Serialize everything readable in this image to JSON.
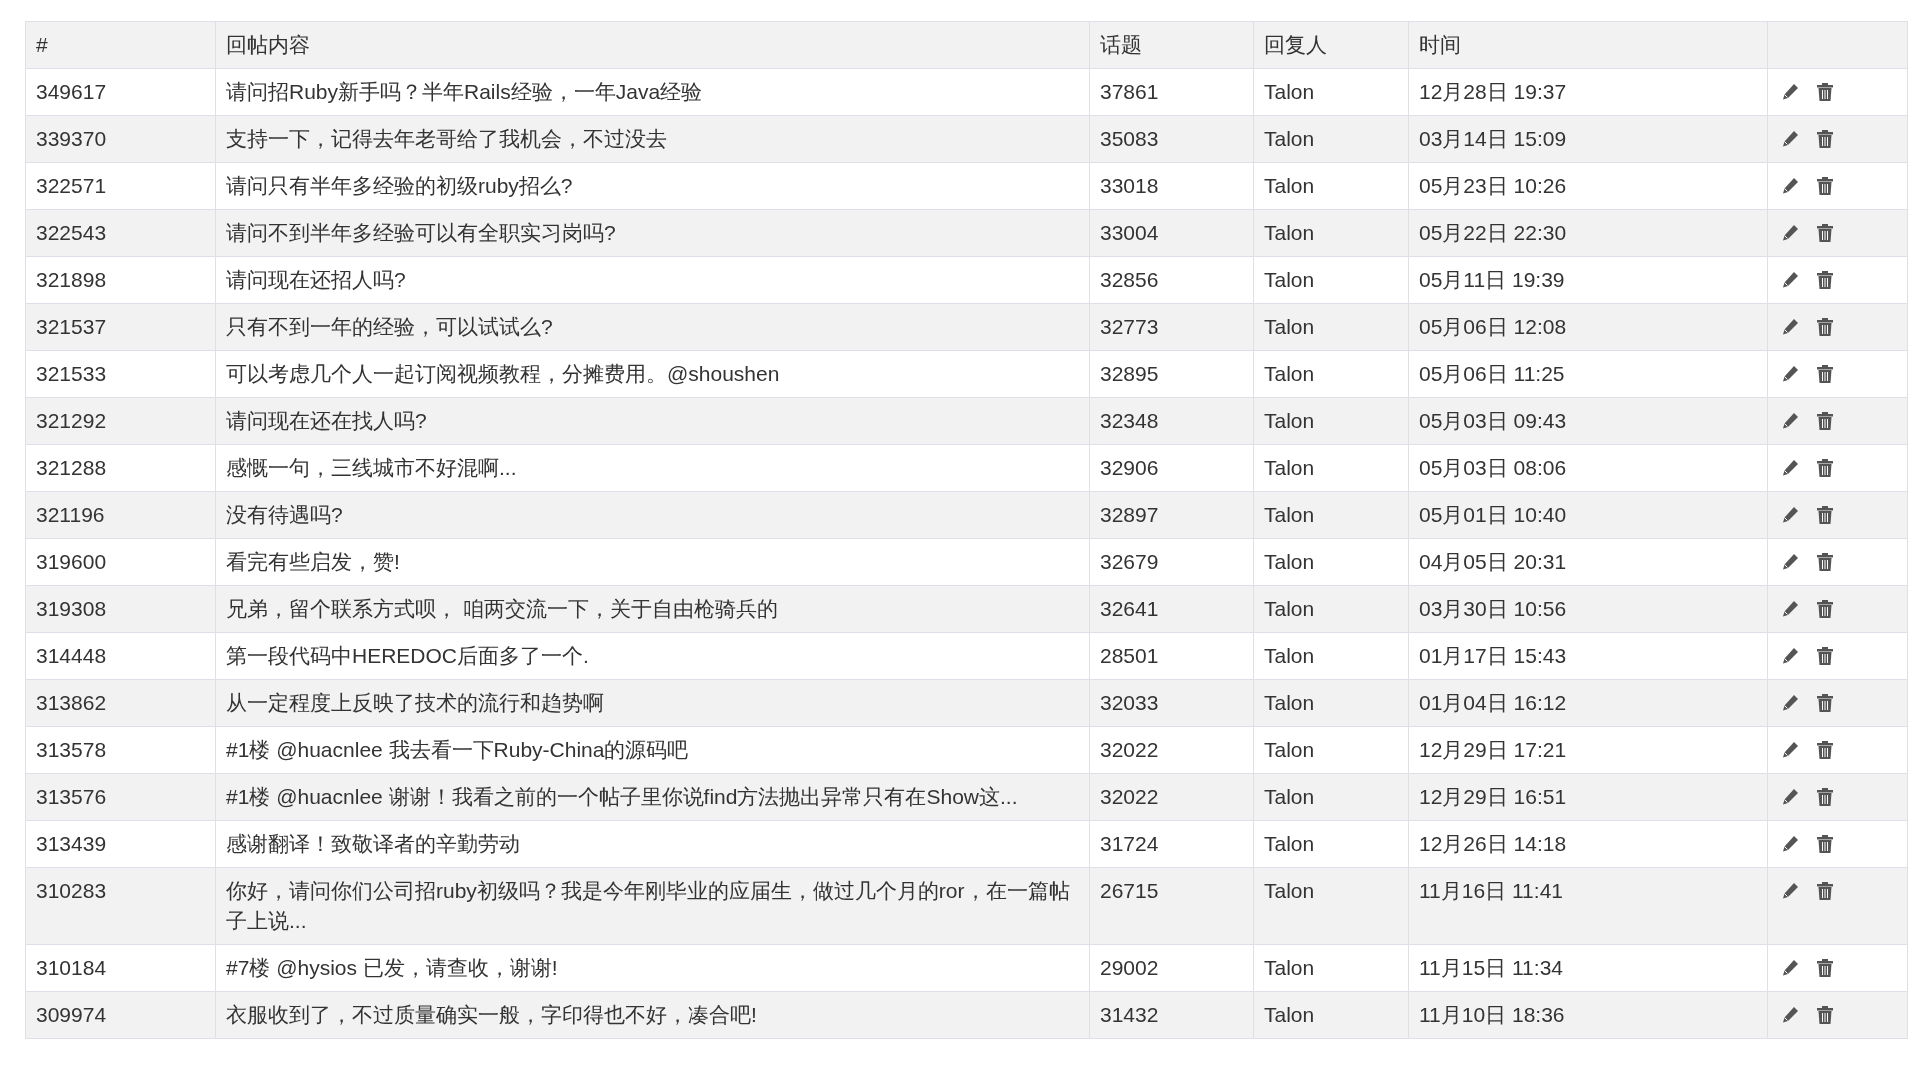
{
  "table": {
    "columns": [
      "#",
      "回帖内容",
      "话题",
      "回复人",
      "时间"
    ],
    "rows": [
      {
        "id": "349617",
        "content": "请问招Ruby新手吗？半年Rails经验，一年Java经验",
        "topic": "37861",
        "replier": "Talon",
        "time": "12月28日 19:37"
      },
      {
        "id": "339370",
        "content": "支持一下，记得去年老哥给了我机会，不过没去",
        "topic": "35083",
        "replier": "Talon",
        "time": "03月14日 15:09"
      },
      {
        "id": "322571",
        "content": "请问只有半年多经验的初级ruby招么?",
        "topic": "33018",
        "replier": "Talon",
        "time": "05月23日 10:26"
      },
      {
        "id": "322543",
        "content": "请问不到半年多经验可以有全职实习岗吗?",
        "topic": "33004",
        "replier": "Talon",
        "time": "05月22日 22:30"
      },
      {
        "id": "321898",
        "content": "请问现在还招人吗?",
        "topic": "32856",
        "replier": "Talon",
        "time": "05月11日 19:39"
      },
      {
        "id": "321537",
        "content": "只有不到一年的经验，可以试试么?",
        "topic": "32773",
        "replier": "Talon",
        "time": "05月06日 12:08"
      },
      {
        "id": "321533",
        "content": "可以考虑几个人一起订阅视频教程，分摊费用。@shoushen",
        "topic": "32895",
        "replier": "Talon",
        "time": "05月06日 11:25"
      },
      {
        "id": "321292",
        "content": "请问现在还在找人吗?",
        "topic": "32348",
        "replier": "Talon",
        "time": "05月03日 09:43"
      },
      {
        "id": "321288",
        "content": "感慨一句，三线城市不好混啊...",
        "topic": "32906",
        "replier": "Talon",
        "time": "05月03日 08:06"
      },
      {
        "id": "321196",
        "content": "没有待遇吗?",
        "topic": "32897",
        "replier": "Talon",
        "time": "05月01日 10:40"
      },
      {
        "id": "319600",
        "content": "看完有些启发，赞!",
        "topic": "32679",
        "replier": "Talon",
        "time": "04月05日 20:31"
      },
      {
        "id": "319308",
        "content": "兄弟，留个联系方式呗， 咱两交流一下，关于自由枪骑兵的",
        "topic": "32641",
        "replier": "Talon",
        "time": "03月30日 10:56"
      },
      {
        "id": "314448",
        "content": "第一段代码中HEREDOC后面多了一个.",
        "topic": "28501",
        "replier": "Talon",
        "time": "01月17日 15:43"
      },
      {
        "id": "313862",
        "content": "从一定程度上反映了技术的流行和趋势啊",
        "topic": "32033",
        "replier": "Talon",
        "time": "01月04日 16:12"
      },
      {
        "id": "313578",
        "content": "#1楼 @huacnlee 我去看一下Ruby-China的源码吧",
        "topic": "32022",
        "replier": "Talon",
        "time": "12月29日 17:21"
      },
      {
        "id": "313576",
        "content": "#1楼 @huacnlee 谢谢！我看之前的一个帖子里你说find方法抛出异常只有在Show这...",
        "topic": "32022",
        "replier": "Talon",
        "time": "12月29日 16:51"
      },
      {
        "id": "313439",
        "content": "感谢翻译！致敬译者的辛勤劳动",
        "topic": "31724",
        "replier": "Talon",
        "time": "12月26日 14:18"
      },
      {
        "id": "310283",
        "content": "你好，请问你们公司招ruby初级吗？我是今年刚毕业的应届生，做过几个月的ror，在一篇帖子上说...",
        "topic": "26715",
        "replier": "Talon",
        "time": "11月16日 11:41"
      },
      {
        "id": "310184",
        "content": "#7楼 @hysios 已发，请查收，谢谢!",
        "topic": "29002",
        "replier": "Talon",
        "time": "11月15日 11:34"
      },
      {
        "id": "309974",
        "content": "衣服收到了，不过质量确实一般，字印得也不好，凑合吧!",
        "topic": "31432",
        "replier": "Talon",
        "time": "11月10日 18:36"
      }
    ]
  }
}
